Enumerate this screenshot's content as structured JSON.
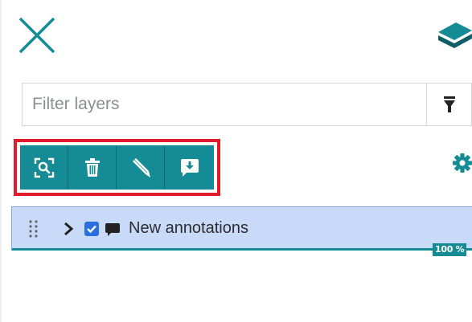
{
  "header": {
    "close_icon": "close-x-icon",
    "layers_icon": "layers-stack-icon"
  },
  "filter": {
    "placeholder": "Filter layers",
    "value": "",
    "filter_icon": "funnel-icon"
  },
  "toolbar": {
    "buttons": [
      {
        "icon": "zoom-to-extent-icon"
      },
      {
        "icon": "trash-icon"
      },
      {
        "icon": "pencil-icon"
      },
      {
        "icon": "comment-download-icon"
      }
    ],
    "settings_icon": "gear-icon"
  },
  "layers": [
    {
      "name": "New annotations",
      "checked": true,
      "type_icon": "comment-icon",
      "progress_label": "100 %",
      "progress_value": 1.0
    }
  ],
  "colors": {
    "accent": "#158b95",
    "highlight_border": "#e11b2a",
    "row_selected_bg": "#c9d9f8",
    "row_selected_border": "#7fa7ea",
    "checkbox": "#2a6fe0"
  }
}
